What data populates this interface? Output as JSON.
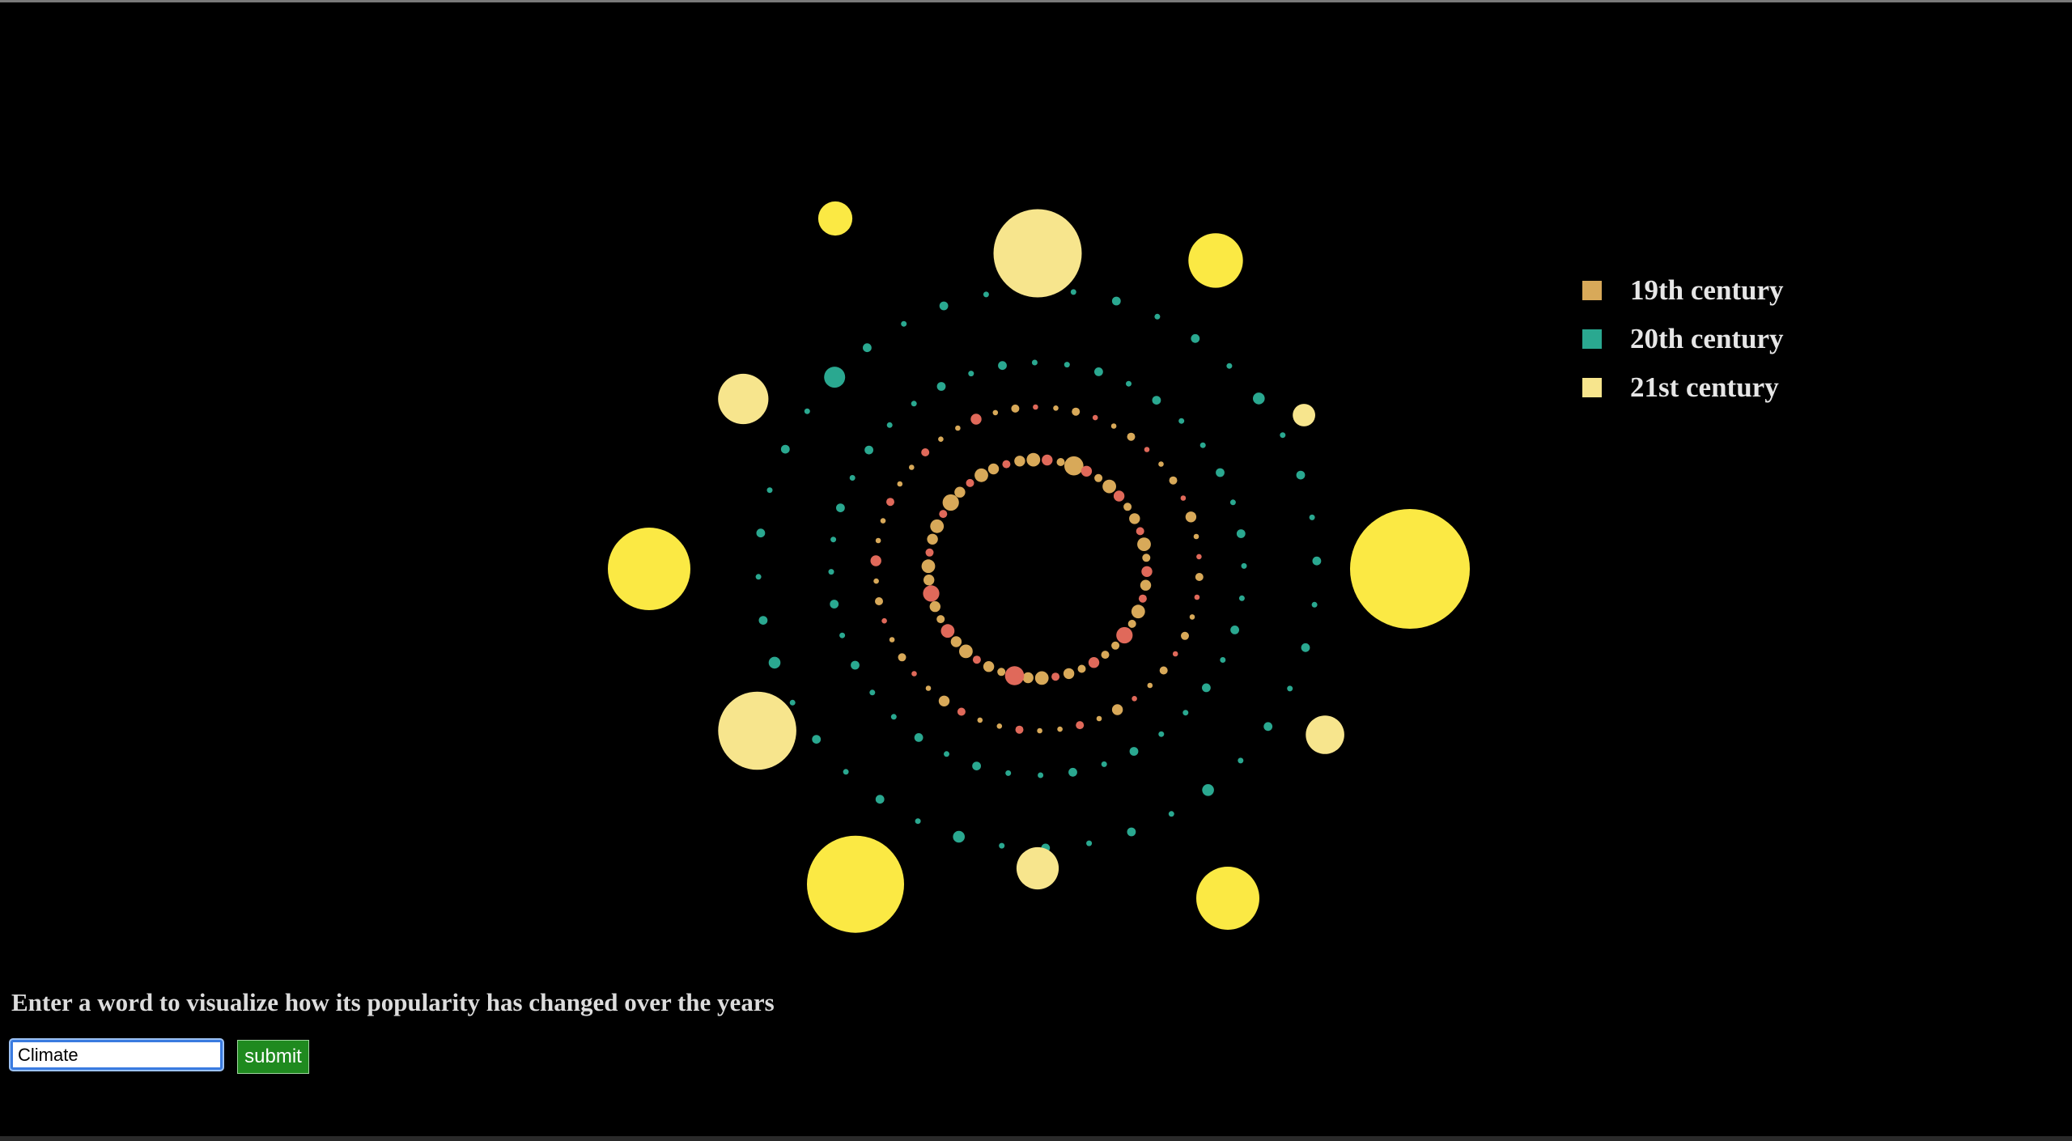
{
  "form": {
    "prompt": "Enter a word to visualize how its popularity has changed over the years",
    "input_value": "Climate",
    "submit_label": "submit"
  },
  "colors": {
    "background": "#000000",
    "c19": "#d8a959",
    "c19_alt": "#e0695a",
    "c20": "#2aa890",
    "c21_light": "#f7e58d",
    "c21_bright": "#fbe944"
  },
  "chart_data": {
    "type": "radial-bubble",
    "title": "",
    "legend": {
      "placement": "right",
      "entries": [
        {
          "label": "19th century",
          "color": "#d8a959"
        },
        {
          "label": "20th century",
          "color": "#2aa890"
        },
        {
          "label": "21st century",
          "color": "#f7e58d"
        }
      ]
    },
    "series": [
      {
        "name": "19th century",
        "rings": [
          {
            "radius_units": 1,
            "values": [
              3,
              2,
              4,
              2,
              5,
              2,
              2,
              3,
              2,
              3,
              2,
              4,
              3,
              6,
              2,
              3,
              2,
              4,
              3,
              4,
              2,
              3,
              5,
              3,
              4,
              2,
              3,
              4,
              2,
              5,
              3,
              2,
              4,
              3,
              2,
              3,
              4,
              3,
              2,
              6,
              3,
              2,
              4,
              3,
              2,
              3,
              2,
              4,
              2,
              3
            ]
          },
          {
            "radius_units": 2,
            "values": [
              2,
              1,
              1,
              2,
              1,
              2,
              1,
              1,
              3,
              1,
              2,
              1,
              1,
              2,
              1,
              1,
              2,
              3,
              1,
              1,
              2,
              1,
              1,
              2,
              1,
              3,
              1,
              1,
              2,
              1,
              1,
              2,
              1,
              1,
              3,
              1,
              2,
              1,
              1,
              2,
              1,
              1,
              2,
              1,
              1,
              2,
              1,
              3,
              1,
              1
            ]
          }
        ]
      },
      {
        "name": "20th century",
        "rings": [
          {
            "radius_units": 3,
            "values": [
              2,
              1,
              2,
              1,
              1,
              2,
              1,
              2,
              1,
              1,
              2,
              1,
              2,
              1,
              1,
              2,
              1,
              2,
              1,
              1,
              2,
              1,
              2,
              1,
              1,
              2,
              1,
              2,
              1,
              1,
              2,
              1,
              2,
              1,
              1,
              2,
              1,
              2,
              1,
              1
            ]
          },
          {
            "radius_units": 4,
            "values": [
              2,
              1,
              3,
              1,
              2,
              1,
              2,
              1,
              3,
              1,
              2,
              1,
              2,
              1,
              3,
              2,
              1,
              2,
              1,
              2,
              1,
              6,
              2,
              1,
              2,
              1,
              3,
              1,
              2,
              1,
              2,
              1,
              3,
              1,
              2,
              1,
              2,
              1,
              2,
              1
            ]
          }
        ]
      },
      {
        "name": "21st century",
        "rings": [
          {
            "radius_units": 5,
            "values": [
              100,
              8,
              25,
              10,
              64,
              40,
              45,
              15,
              6,
              52,
              18,
              2
            ]
          }
        ]
      }
    ]
  }
}
